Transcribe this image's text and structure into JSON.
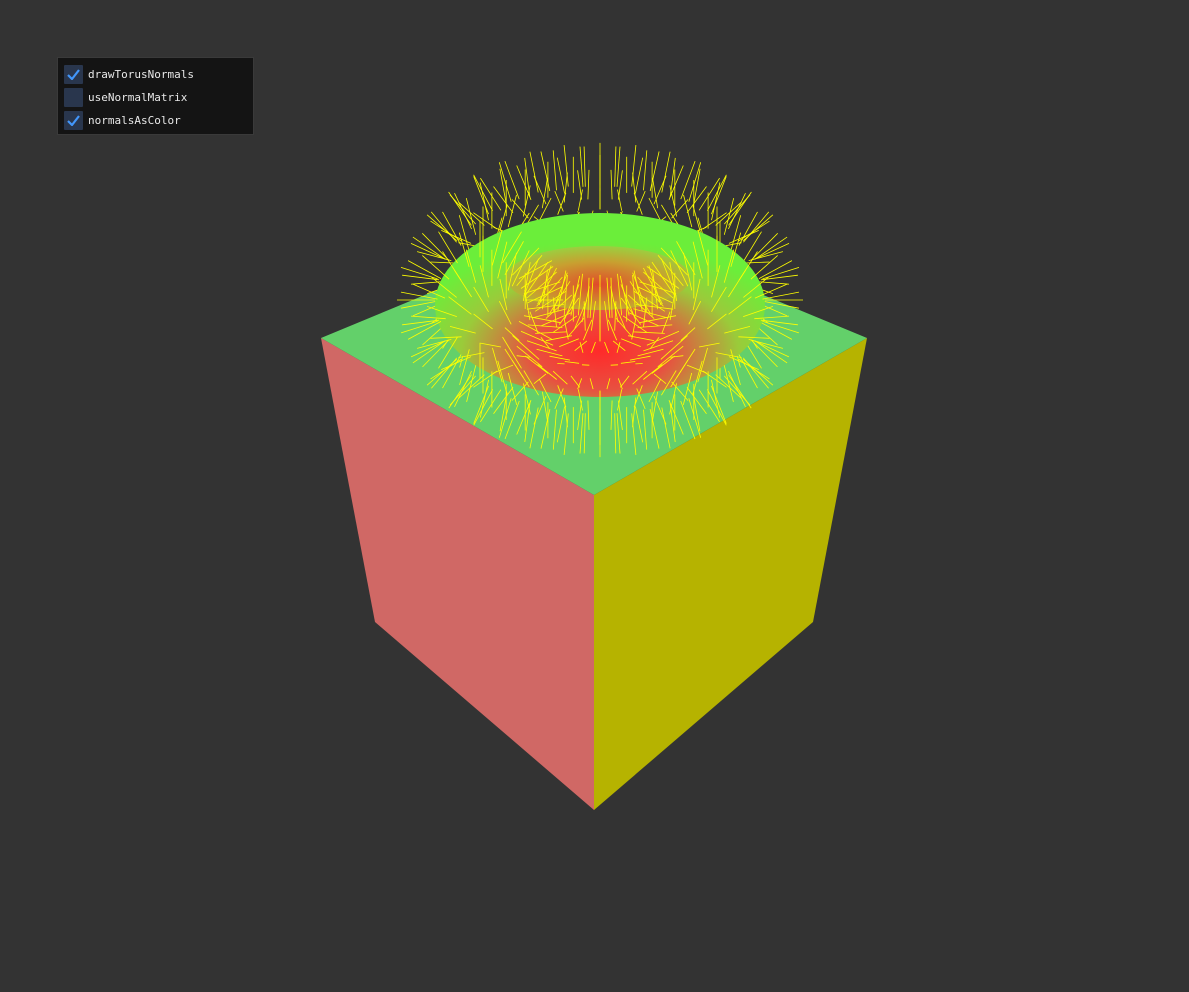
{
  "panel": {
    "options": [
      {
        "label": "drawTorusNormals",
        "checked": true
      },
      {
        "label": "useNormalMatrix",
        "checked": false
      },
      {
        "label": "normalsAsColor",
        "checked": true
      }
    ]
  },
  "colors": {
    "background": "#333333",
    "panel_bg": "#141414",
    "checkbox_bg": "#29364d",
    "check_mark": "#4296fa",
    "cube_top": "#63d06a",
    "cube_left": "#d06865",
    "cube_right": "#b6b300",
    "normals": "#ffff00"
  }
}
